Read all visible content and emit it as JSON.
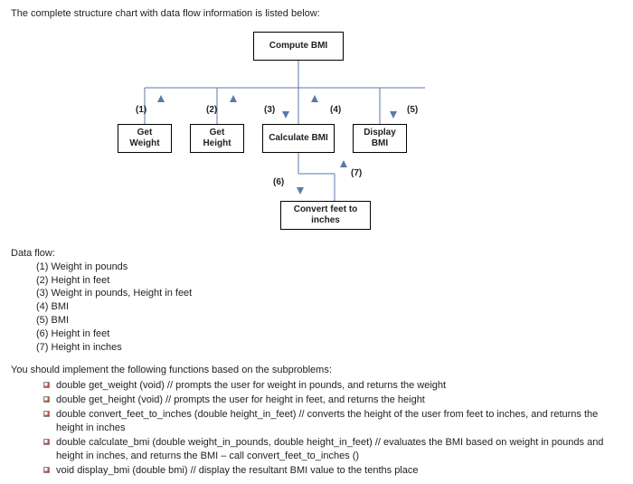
{
  "intro": "The complete structure chart with data flow information is listed below:",
  "chart_data": {
    "type": "structure-chart",
    "nodes": [
      {
        "id": "root",
        "label": "Compute BMI"
      },
      {
        "id": "gw",
        "label": "Get Weight"
      },
      {
        "id": "gh",
        "label": "Get Height"
      },
      {
        "id": "cb",
        "label": "Calculate BMI"
      },
      {
        "id": "db",
        "label": "Display BMI"
      },
      {
        "id": "cfi",
        "label": "Convert feet to inches"
      }
    ],
    "edges": [
      {
        "from": "root",
        "to": "gw",
        "label": "(1)",
        "dir": "up"
      },
      {
        "from": "root",
        "to": "gh",
        "label": "(2)",
        "dir": "up"
      },
      {
        "from": "root",
        "to": "cb",
        "label": "(3)",
        "dir": "down"
      },
      {
        "from": "cb",
        "to": "root",
        "label": "(4)",
        "dir": "up"
      },
      {
        "from": "root",
        "to": "db",
        "label": "(5)",
        "dir": "down"
      },
      {
        "from": "cb",
        "to": "cfi",
        "label": "(6)",
        "dir": "down"
      },
      {
        "from": "cfi",
        "to": "cb",
        "label": "(7)",
        "dir": "up"
      }
    ],
    "labels": {
      "1": "(1)",
      "2": "(2)",
      "3": "(3)",
      "4": "(4)",
      "5": "(5)",
      "6": "(6)",
      "7": "(7)"
    }
  },
  "legend": {
    "heading": "Data flow:",
    "items": [
      "(1) Weight in pounds",
      "(2) Height in feet",
      "(3) Weight in pounds, Height in feet",
      "(4) BMI",
      "(5) BMI",
      "(6) Height in feet",
      "(7) Height in inches"
    ]
  },
  "func_intro": "You should implement the following functions based on the subproblems:",
  "functions": [
    "double get_weight (void) // prompts the user for weight in pounds, and returns the weight",
    "double get_height (void) // prompts the user for height in feet, and returns the height",
    "double convert_feet_to_inches (double height_in_feet) // converts the height of the user from feet to inches, and returns the height in inches",
    "double calculate_bmi (double weight_in_pounds, double height_in_feet) // evaluates the BMI based on weight in pounds and height in inches, and returns the BMI – call convert_feet_to_inches ()",
    "void display_bmi (double bmi) // display the resultant BMI value to the tenths place"
  ]
}
